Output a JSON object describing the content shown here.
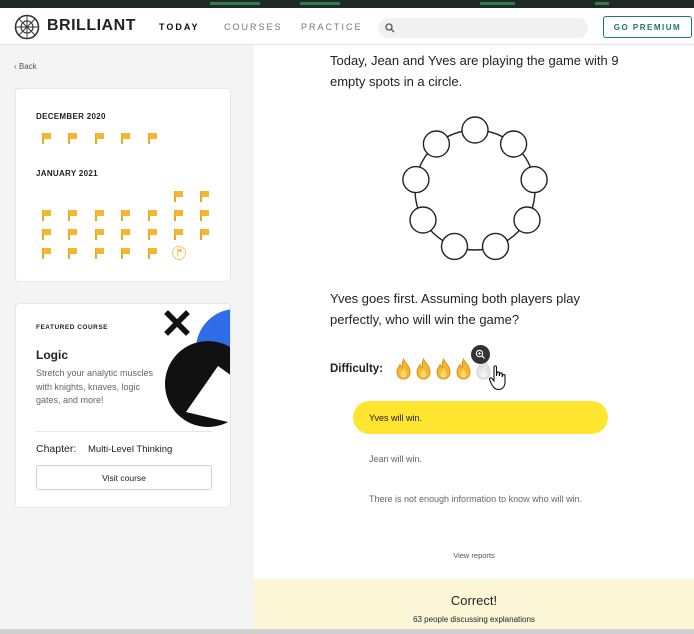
{
  "header": {
    "logo_text": "BRILLIANT",
    "nav": [
      {
        "label": "TODAY",
        "active": true
      },
      {
        "label": "COURSES",
        "active": false
      },
      {
        "label": "PRACTICE",
        "active": false
      }
    ],
    "search_placeholder": "",
    "premium_label": "GO PREMIUM"
  },
  "sidebar": {
    "back_label": "‹ Back",
    "calendar": {
      "months": [
        {
          "label": "DECEMBER 2020",
          "completed_days": 5
        },
        {
          "label": "JANUARY 2021",
          "completed_days": 21
        }
      ]
    },
    "featured": {
      "label": "FEATURED COURSE",
      "title": "Logic",
      "description": "Stretch your analytic muscles with knights, knaves, logic gates, and more!",
      "chapter_label": "Chapter:",
      "chapter_value": "Multi-Level Thinking",
      "visit_label": "Visit course"
    }
  },
  "main": {
    "intro": "Today, Jean and Yves are playing the game with 9 empty spots in a circle.",
    "question": "Yves goes first. Assuming both players play perfectly, who will win the game?",
    "difficulty_label": "Difficulty:",
    "difficulty_level": 4,
    "difficulty_max": 5,
    "options": [
      {
        "label": "Yves will win.",
        "selected": true
      },
      {
        "label": "Jean will win.",
        "selected": false
      },
      {
        "label": "There is not enough information to know who will win.",
        "selected": false
      }
    ],
    "reports_label": "View reports",
    "result_title": "Correct!",
    "discussion": "63 people discussing explanations"
  },
  "colors": {
    "accent_teal": "#1a7a6a",
    "selected_yellow": "#ffe52f",
    "flag_orange": "#f5b731",
    "result_bg": "#fcf8d7"
  }
}
